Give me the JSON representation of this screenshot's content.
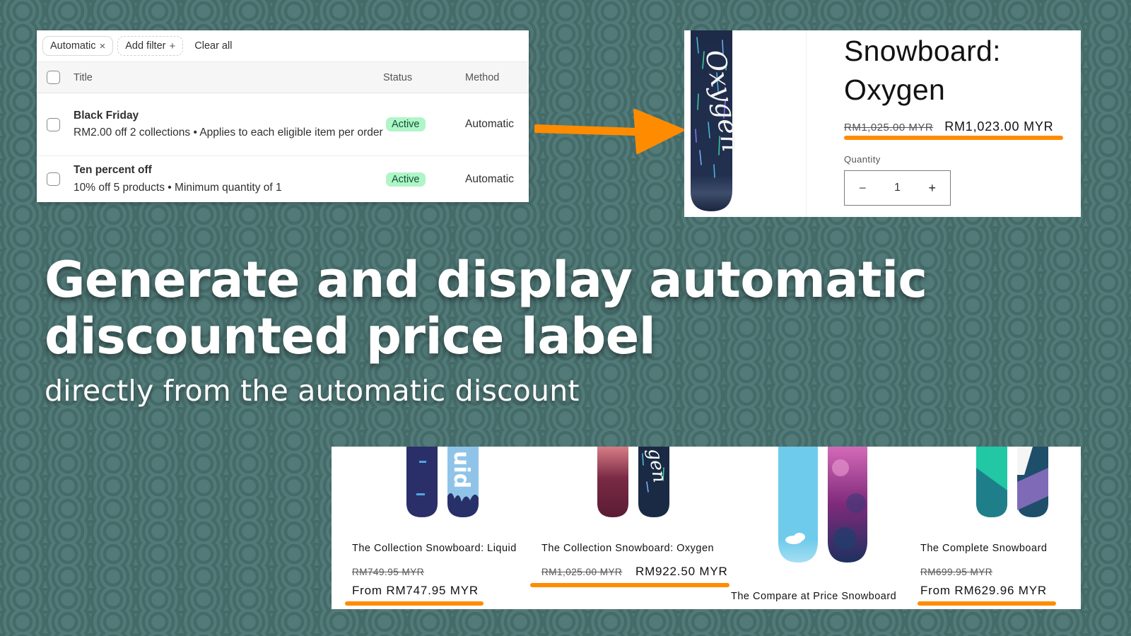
{
  "colors": {
    "background": "#4f7876",
    "accent_orange": "#ff8c00",
    "badge_bg": "#aff5c7",
    "badge_text": "#0c5132"
  },
  "admin": {
    "filters": {
      "applied_chip": "Automatic",
      "remove_icon": "close-icon",
      "add_filter": "Add filter",
      "add_icon": "plus-icon",
      "clear_all": "Clear all"
    },
    "columns": {
      "title": "Title",
      "status": "Status",
      "method": "Method"
    },
    "rows": [
      {
        "name": "Black Friday",
        "summary": "RM2.00 off 2 collections • Applies to each eligible item per order",
        "status": "Active",
        "method": "Automatic"
      },
      {
        "name": "Ten percent off",
        "summary": "10% off 5 products • Minimum quantity of 1",
        "status": "Active",
        "method": "Automatic"
      }
    ]
  },
  "product": {
    "title_line1": "Snowboard:",
    "title_line2": "Oxygen",
    "compare_price": "RM1,025.00 MYR",
    "price": "RM1,023.00 MYR",
    "quantity_label": "Quantity",
    "quantity": "1",
    "decrement": "−",
    "increment": "+",
    "board_text": "Oxygen"
  },
  "headline": {
    "line1": "Generate and display automatic",
    "line2": "discounted price label",
    "subline": "directly from the automatic discount"
  },
  "collection": [
    {
      "title": "The Collection Snowboard: Liquid",
      "compare_price": "RM749.95 MYR",
      "price": "From RM747.95 MYR",
      "highlighted": true
    },
    {
      "title": "The Collection Snowboard: Oxygen",
      "compare_price": "RM1,025.00 MYR",
      "price": "RM922.50 MYR",
      "highlighted": true
    },
    {
      "title": "The Compare at Price Snowboard",
      "compare_price": "",
      "price": "",
      "highlighted": false
    },
    {
      "title": "The Complete Snowboard",
      "compare_price": "RM699.95 MYR",
      "price": "From RM629.96 MYR",
      "highlighted": true
    }
  ]
}
